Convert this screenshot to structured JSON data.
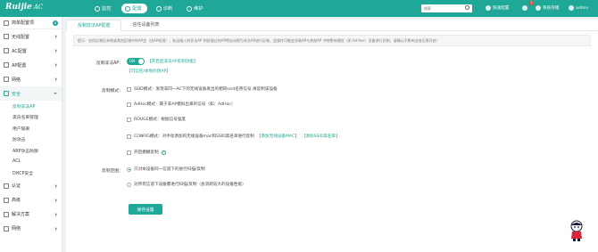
{
  "header": {
    "logo": "Ruijie",
    "logo_suffix": "AC",
    "nav": [
      {
        "label": "监控",
        "icon": "monitor-icon"
      },
      {
        "label": "配置",
        "icon": "config-icon",
        "active": true
      },
      {
        "label": "诊断",
        "icon": "diagnose-icon"
      },
      {
        "label": "维护",
        "icon": "maintain-icon"
      }
    ],
    "search_placeholder": "搜索",
    "quick_config": "快速配置",
    "notification_count": "1",
    "system_ops": "系统存储",
    "user": "admin",
    "accent": "#1fa797"
  },
  "sidebar": {
    "head_label": "简单配置项",
    "head_count": "0",
    "items_top": [
      {
        "label": "无线配置",
        "name": "wireless"
      },
      {
        "label": "AC配置",
        "name": "ac"
      },
      {
        "label": "AP配置",
        "name": "ap"
      },
      {
        "label": "网络",
        "name": "network"
      }
    ],
    "open_item": "安全",
    "sub_items": [
      "反制非法AP",
      "黑白名单管理",
      "用户隔离",
      "防攻击",
      "ARP攻击防御",
      "ACL",
      "DHCP安全"
    ],
    "active_sub": "反制非法AP",
    "items_bottom": [
      {
        "label": "认证",
        "name": "auth"
      },
      {
        "label": "高级",
        "name": "advanced"
      },
      {
        "label": "解决方案",
        "name": "solution"
      },
      {
        "label": "网络",
        "name": "network2"
      }
    ]
  },
  "main": {
    "tabs": [
      "反制非法AP配置",
      "信任设备列表"
    ],
    "notice": "提示：启用反制后本地或其他区域中的AP会（由AP检测），私自接入的非法AP 和处理过的AP将自动视为非法AP进行反制。此操作可能会导致AP与其他AP 冲突影响通信（如 Ad-hoc）设备进行反制，请确认不影响业务后再开启！",
    "enable_label": "反制非法AP：",
    "toggle_text": "ON",
    "toggle_note": "【开启后非法AP反制功能】",
    "toggle_link": "【可信任/本地的伪AP】",
    "mode_label": "反制模式：",
    "modes": [
      {
        "text": "SSID模式：发现非同一AC下的无线设备发出的相同ssid名称信号,将反制该设备",
        "links": []
      },
      {
        "text": "AdHoc模式：属于非AP模拟出来的信号（如：AdHoc）",
        "links": []
      },
      {
        "text": "ROUGE模式：根据信号强度",
        "links": []
      },
      {
        "text": "CONFIG模式：对手动添加的无线设备mac和SSID黑名单进行反制",
        "links": [
          "【添加无线设备MAC】",
          "【添加SSID黑名单】"
        ]
      },
      {
        "text": "开启模糊反制",
        "links": [],
        "help": true
      }
    ],
    "range_label": "反制范围：",
    "ranges": [
      {
        "text": "只对本设备同一信道下的进行扫描/反制",
        "selected": true
      },
      {
        "text": "对所有信道下设备都进行扫描/反制（会消耗较大的设备性能）",
        "selected": false
      }
    ],
    "save_button": "保存设置"
  }
}
